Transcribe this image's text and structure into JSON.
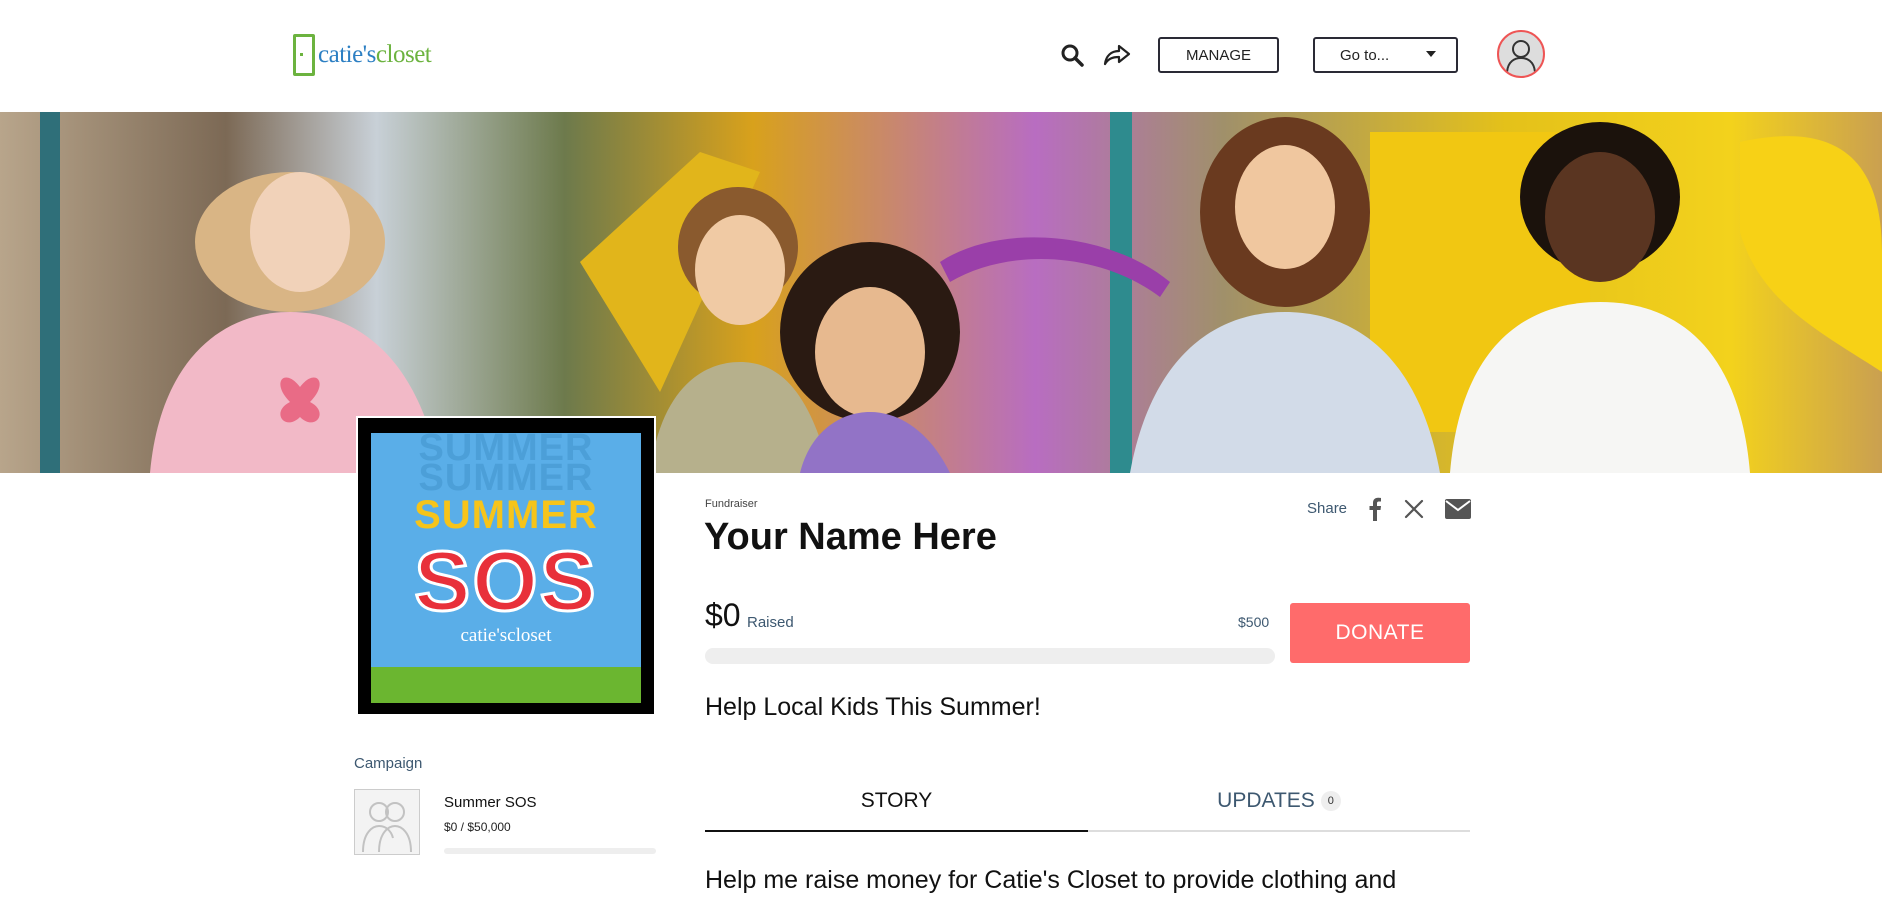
{
  "header": {
    "logo_part1": "catie's",
    "logo_part2": "closet",
    "manage_label": "MANAGE",
    "goto_label": "Go to...",
    "icons": {
      "search": "search-icon",
      "share": "share-arrow-icon",
      "user": "user-icon",
      "caret": "caret-down-icon"
    }
  },
  "poster": {
    "ghost1": "SUMMER",
    "ghost2": "SUMMER",
    "line1": "SUMMER",
    "line2": "SOS",
    "brand": "catie'scloset"
  },
  "campaign": {
    "section_label": "Campaign",
    "name": "Summer SOS",
    "amount": "$0 / $50,000",
    "progress_fraction": 0
  },
  "fundraiser": {
    "type_label": "Fundraiser",
    "name": "Your Name Here",
    "share_label": "Share",
    "raised_amount": "$0",
    "raised_label": "Raised",
    "goal": "$500",
    "progress_fraction": 0,
    "donate_label": "DONATE",
    "tagline": "Help Local Kids This Summer!"
  },
  "tabs": {
    "story": "STORY",
    "updates": "UPDATES",
    "updates_count": "0"
  },
  "story": {
    "first_line": "Help me raise money for Catie's Closet to provide clothing and"
  },
  "colors": {
    "accent": "#ff6b6b",
    "brand_green": "#6cb33f",
    "brand_blue": "#2c7fc3",
    "muted_text": "#3d5870"
  }
}
